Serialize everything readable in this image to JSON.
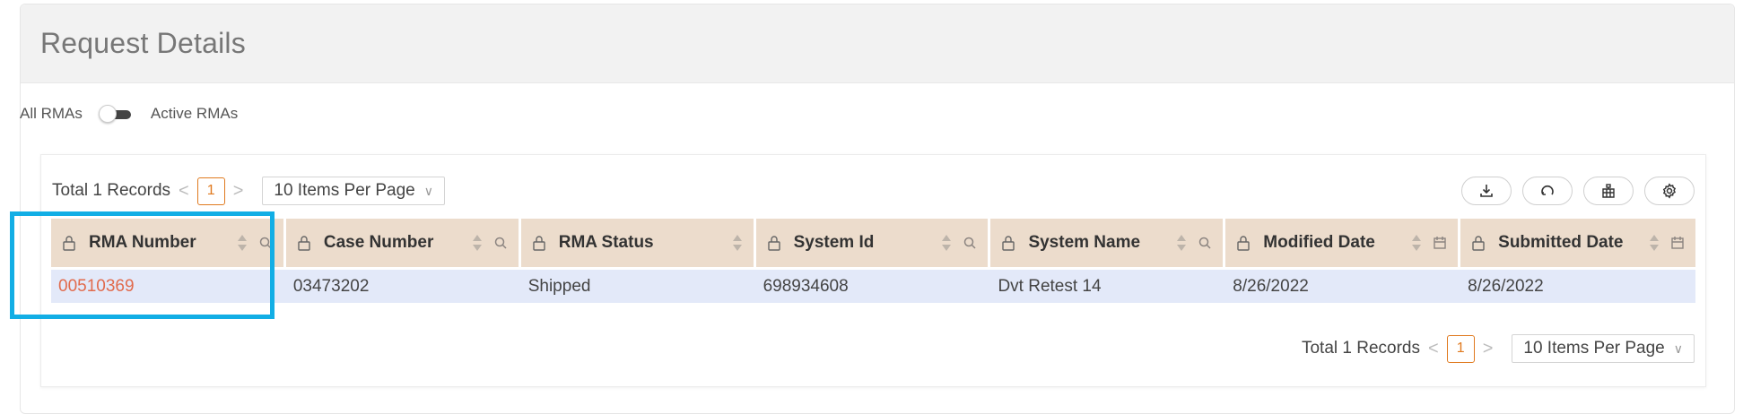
{
  "header": {
    "title": "Request Details"
  },
  "filter": {
    "left_label": "All RMAs",
    "right_label": "Active RMAs",
    "active": false
  },
  "pager_top": {
    "total_text": "Total 1 Records",
    "prev": "<",
    "page": "1",
    "next": ">",
    "per_page": "10 Items Per Page",
    "chevron": "∨"
  },
  "pager_bottom": {
    "total_text": "Total 1 Records",
    "prev": "<",
    "page": "1",
    "next": ">",
    "per_page": "10 Items Per Page",
    "chevron": "∨"
  },
  "toolbar": {
    "icons": [
      "download-icon",
      "refresh-icon",
      "column-chooser-icon",
      "settings-icon"
    ]
  },
  "table": {
    "columns": [
      {
        "label": "RMA Number",
        "aux": "search-icon"
      },
      {
        "label": "Case Number",
        "aux": "search-icon"
      },
      {
        "label": "RMA Status",
        "aux": ""
      },
      {
        "label": "System Id",
        "aux": "search-icon"
      },
      {
        "label": "System Name",
        "aux": "search-icon"
      },
      {
        "label": "Modified Date",
        "aux": "calendar-icon"
      },
      {
        "label": "Submitted Date",
        "aux": "calendar-icon"
      }
    ],
    "rows": [
      [
        "00510369",
        "03473202",
        "Shipped",
        "698934608",
        "Dvt Retest 14",
        "8/26/2022",
        "8/26/2022"
      ]
    ]
  },
  "colors": {
    "header_bg": "#ecdccc",
    "row_bg": "#e3e9f9",
    "link": "#e16b4d",
    "pager_accent": "#e07a1f",
    "highlight": "#12aee5"
  }
}
